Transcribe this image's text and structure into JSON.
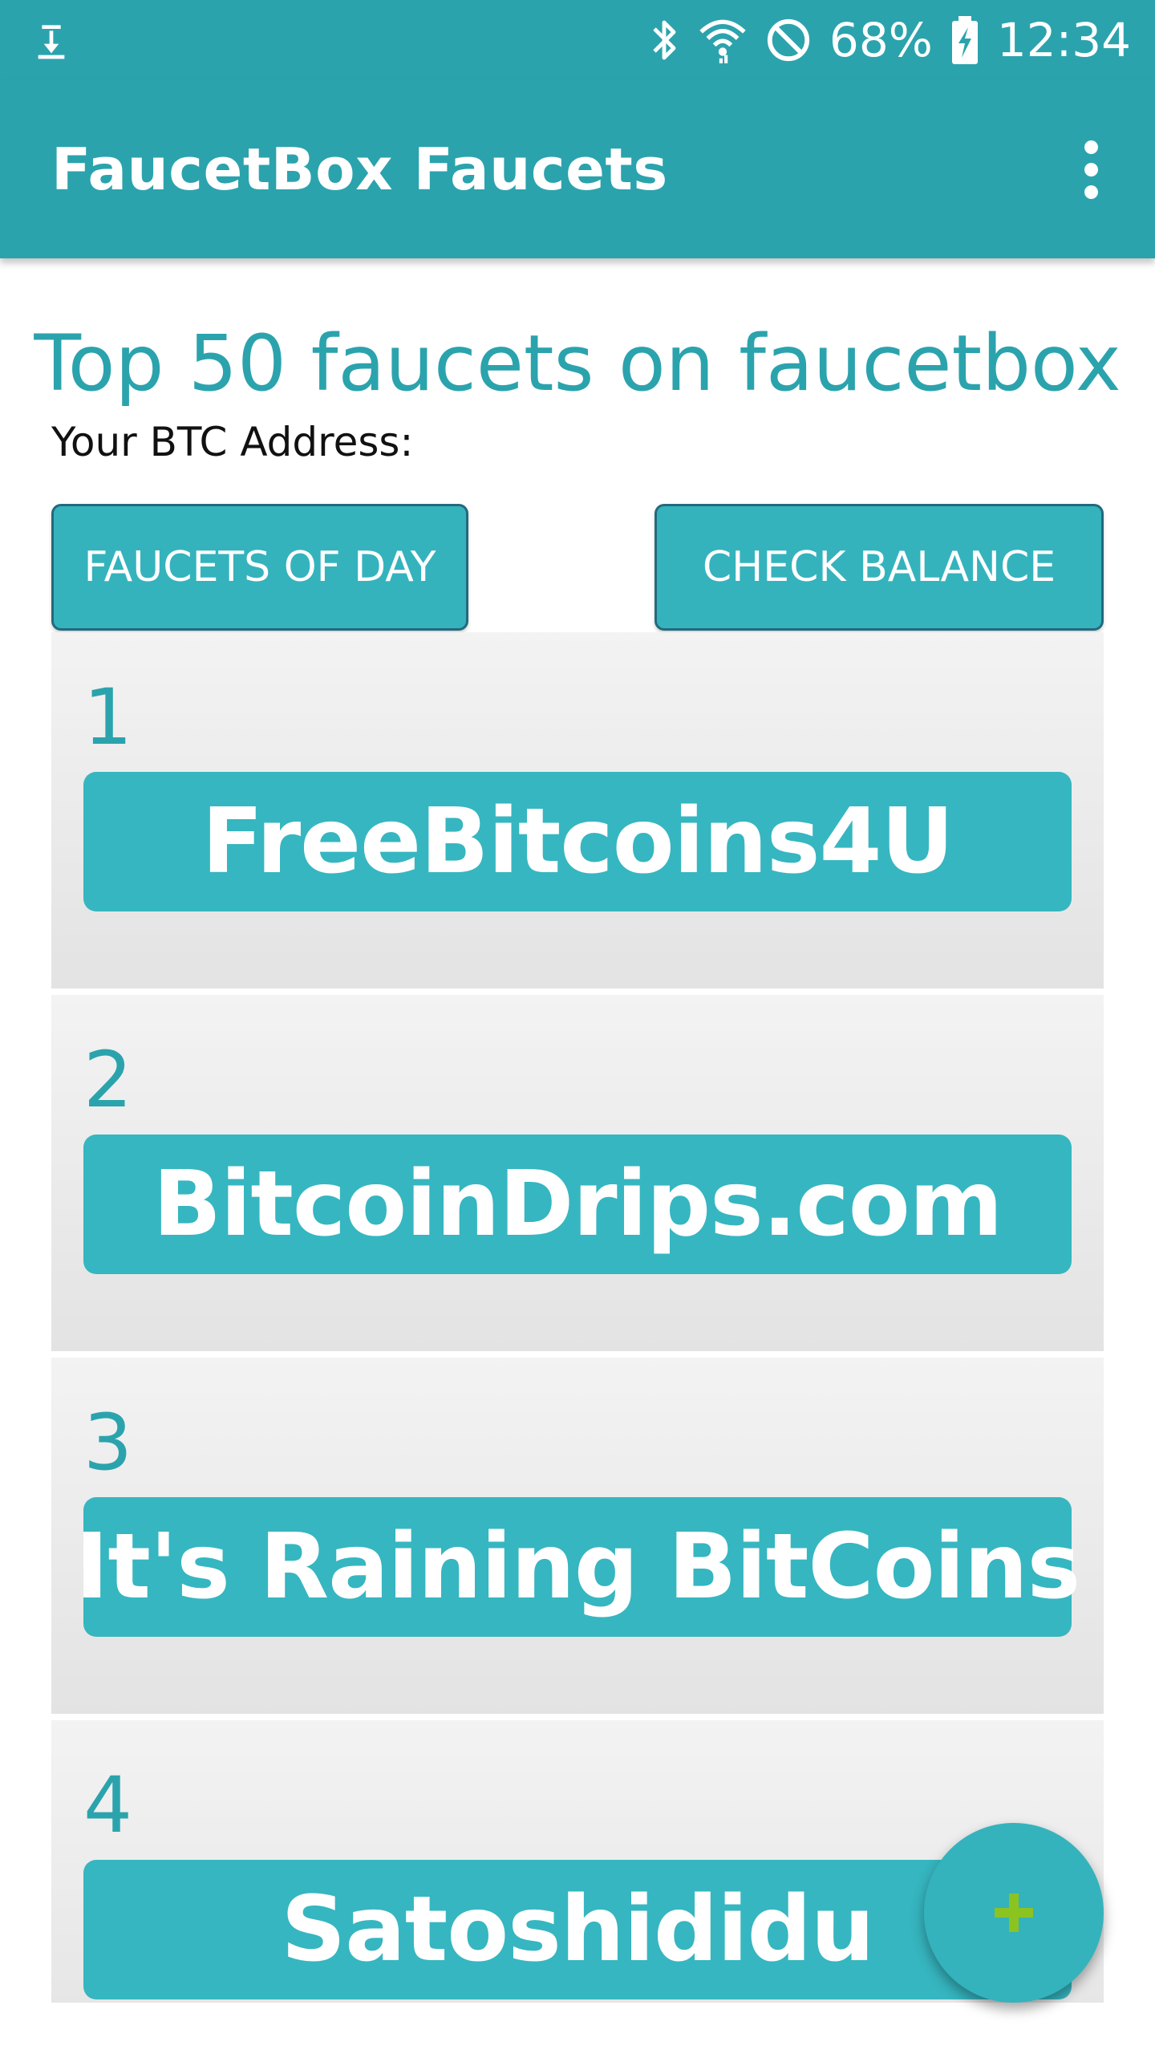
{
  "status_bar": {
    "battery_percent": "68%",
    "time": "12:34",
    "icons": [
      "download-icon",
      "bluetooth-icon",
      "wifi-icon",
      "do-not-disturb-icon",
      "battery-charging-icon"
    ]
  },
  "app_bar": {
    "title": "FaucetBox Faucets",
    "menu_icon": "overflow-menu-icon"
  },
  "main": {
    "heading": "Top 50 faucets on faucetbox",
    "btc_address_label": "Your BTC Address:",
    "buttons": {
      "faucets_of_day": "FAUCETS OF DAY",
      "check_balance": "CHECK BALANCE"
    }
  },
  "faucets": [
    {
      "rank": "1",
      "name": "FreeBitcoins4U"
    },
    {
      "rank": "2",
      "name": "BitcoinDrips.com"
    },
    {
      "rank": "3",
      "name": "It's Raining BitCoins"
    },
    {
      "rank": "4",
      "name": "Satoshididu"
    }
  ],
  "fab": {
    "icon": "plus-icon",
    "icon_color": "#8bc320"
  },
  "colors": {
    "primary": "#2ba3ad",
    "button": "#34b3bd",
    "button_border": "#24697d",
    "card_bg": "#eeeeee"
  }
}
